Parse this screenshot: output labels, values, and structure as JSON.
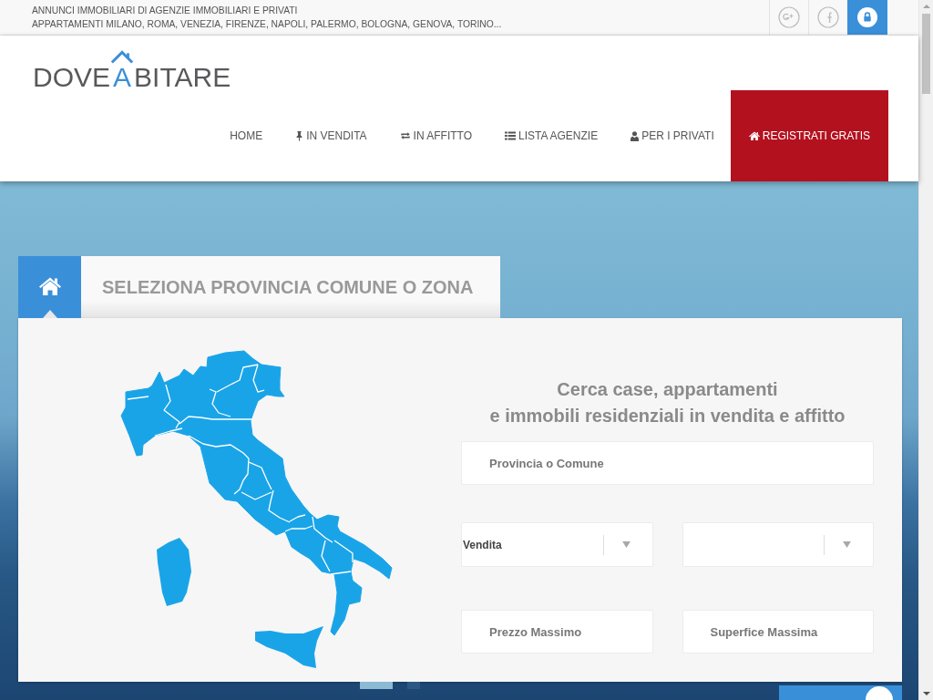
{
  "top_bar": {
    "lines": [
      "ANNUNCI IMMOBILIARI DI AGENZIE IMMOBILIARI E PRIVATI",
      "APPARTAMENTI MILANO, ROMA, VENEZIA, FIRENZE, NAPOLI, PALERMO, BOLOGNA, GENOVA, TORINO..."
    ],
    "buttons": [
      {
        "kind": "googleplus"
      },
      {
        "kind": "facebook"
      },
      {
        "kind": "login"
      }
    ]
  },
  "logo": {
    "before": "DOVE",
    "house_letter": "A",
    "after": "BITARE"
  },
  "nav": [
    {
      "label": "HOME",
      "kind": "plain",
      "highlighted": false
    },
    {
      "label": "IN VENDITA",
      "kind": "pin",
      "highlighted": false
    },
    {
      "label": "IN AFFITTO",
      "kind": "swap",
      "highlighted": false
    },
    {
      "label": "LISTA AGENZIE",
      "kind": "list",
      "highlighted": false
    },
    {
      "label": "PER I PRIVATI",
      "kind": "user",
      "highlighted": false
    },
    {
      "label": "REGISTRATI GRATIS",
      "kind": "home",
      "highlighted": true
    }
  ],
  "search_panel": {
    "tab": {
      "title": "SELEZIONA PROVINCIA COMUNE O ZONA"
    },
    "heading": [
      "Cerca case, appartamenti",
      "e immobili residenziali in vendita e affitto"
    ],
    "field_rows": [
      [
        {
          "kind": "text",
          "placeholder": "Provincia o Comune"
        }
      ],
      [
        {
          "kind": "select",
          "value": "Vendita"
        },
        {
          "kind": "select"
        }
      ],
      [
        {
          "kind": "text",
          "placeholder": "Prezzo Massimo"
        },
        {
          "kind": "text",
          "placeholder": "Superfice Massima"
        }
      ]
    ]
  },
  "slides": [
    {
      "selected": true
    },
    {
      "selected": false
    }
  ]
}
